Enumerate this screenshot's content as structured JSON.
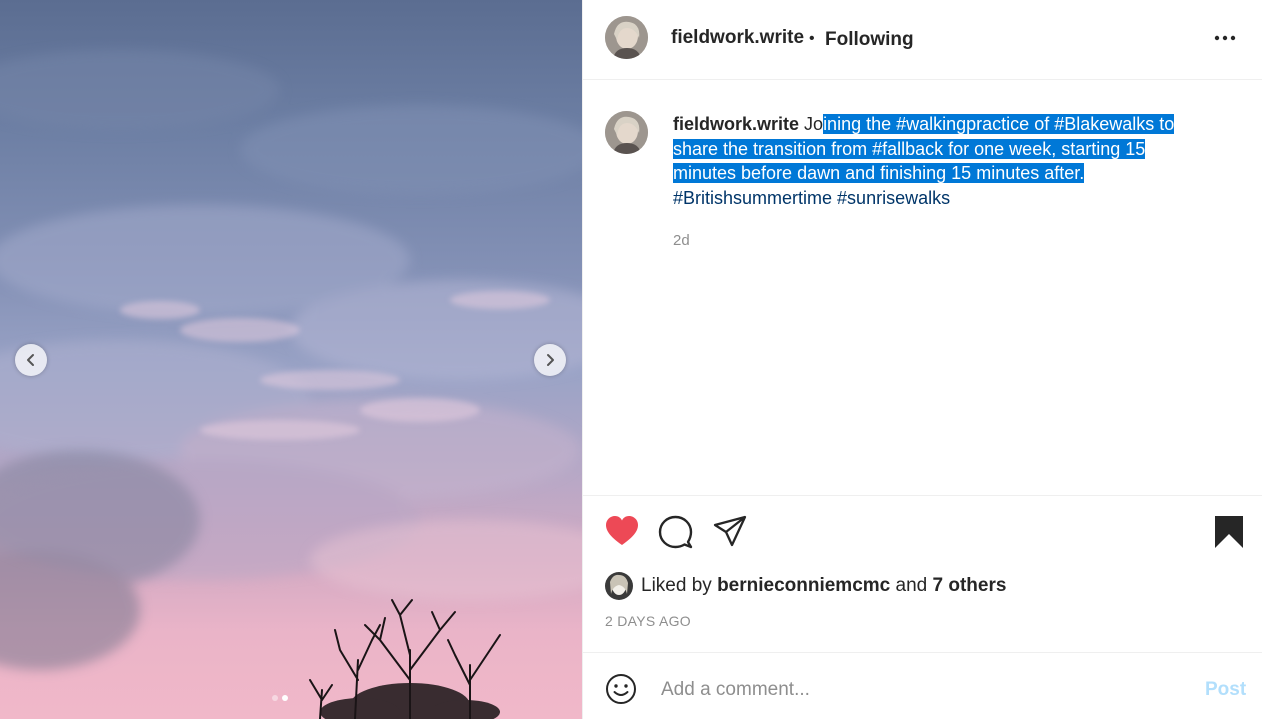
{
  "post": {
    "username": "fieldwork.write",
    "follow_state": "Following",
    "caption_start": "Jo",
    "caption_selected_1": "ining the ",
    "tag_walkingpractice": "#walkingpractice",
    "caption_of": " of ",
    "tag_blakewalks": "#Blakewalks",
    "caption_mid": " to share the transition from ",
    "tag_fallback": "#fallback",
    "caption_rest": " for one week, starting 15 minutes before dawn and finishing 15 minutes after.",
    "tag_britishsummertime": "#Britishsummertime",
    "tag_sunrisewalks": "#sunrisewalks",
    "relative_time": "2d",
    "liked_by_prefix": "Liked by",
    "liked_by_user": "bernieconniemcmc",
    "liked_by_and": "and",
    "liked_by_others": "7 others",
    "date_label": "2 DAYS AGO"
  },
  "comment_box": {
    "placeholder": "Add a comment...",
    "post_label": "Post"
  },
  "carousel": {
    "slide_count": 2,
    "active_index": 1
  },
  "icons": {
    "like": "heart-filled-icon",
    "comment": "comment-bubble-icon",
    "share": "paper-plane-icon",
    "save": "bookmark-filled-icon",
    "more": "more-dots-icon",
    "emoji": "smiley-icon",
    "prev": "chevron-left-icon",
    "next": "chevron-right-icon"
  },
  "colors": {
    "like": "#ed4956",
    "selection": "#0078d7",
    "hashtag": "#003569",
    "post_disabled": "#b2dffc",
    "muted": "#8e8e8e"
  }
}
